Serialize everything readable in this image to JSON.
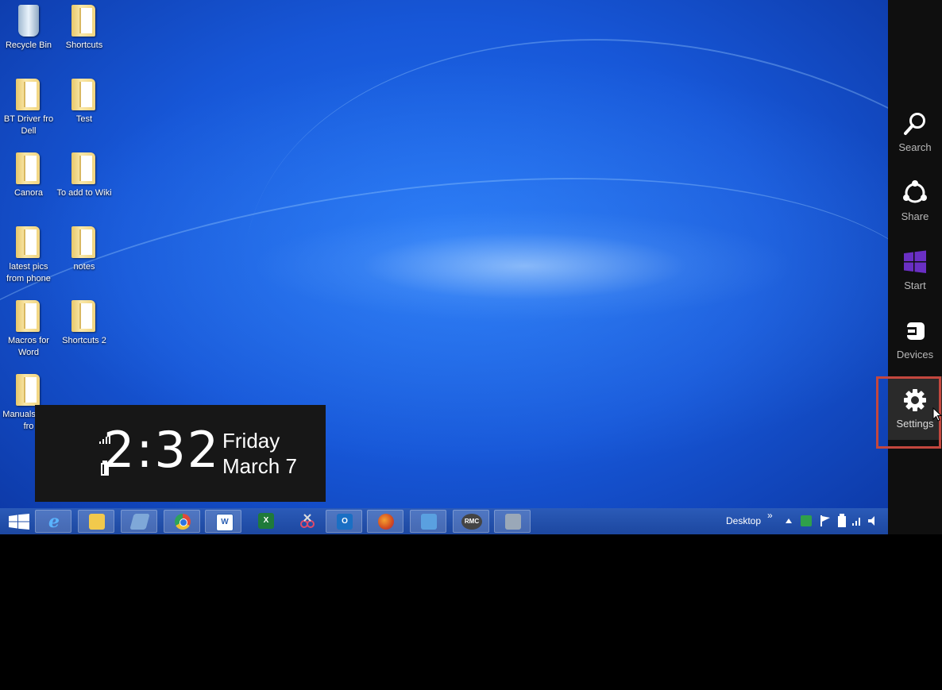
{
  "desktop_icons": [
    {
      "label": "Recycle Bin",
      "type": "bin"
    },
    {
      "label": "Shortcuts",
      "type": "folder"
    },
    {
      "label": "BT Driver fro Dell",
      "type": "folder"
    },
    {
      "label": "Test",
      "type": "folder"
    },
    {
      "label": "Canora",
      "type": "folder"
    },
    {
      "label": "To add to Wiki",
      "type": "folder"
    },
    {
      "label": "latest pics from phone",
      "type": "folder"
    },
    {
      "label": "notes",
      "type": "folder"
    },
    {
      "label": "Macros for Word",
      "type": "folder"
    },
    {
      "label": "Shortcuts 2",
      "type": "folder"
    },
    {
      "label": "Manuals past fro",
      "type": "folder"
    }
  ],
  "clock": {
    "time": "2:32",
    "day": "Friday",
    "date": "March 7"
  },
  "charms": [
    {
      "label": "Search",
      "icon": "search-icon"
    },
    {
      "label": "Share",
      "icon": "share-icon"
    },
    {
      "label": "Start",
      "icon": "windows-logo-icon"
    },
    {
      "label": "Devices",
      "icon": "devices-icon"
    },
    {
      "label": "Settings",
      "icon": "gear-icon"
    }
  ],
  "taskbar": {
    "apps": [
      {
        "name": "internet-explorer",
        "glyph": "e",
        "color": "#3aa0ff"
      },
      {
        "name": "file-explorer",
        "glyph": "",
        "color": "#f2c94c"
      },
      {
        "name": "notepad-app",
        "glyph": "",
        "color": "#7fa8d8"
      },
      {
        "name": "chrome",
        "glyph": "",
        "color": "#e04a3a"
      },
      {
        "name": "word",
        "glyph": "W",
        "color": "#2b5fb3"
      },
      {
        "name": "excel",
        "glyph": "X",
        "color": "#1f7a3a"
      },
      {
        "name": "snipping-tool",
        "glyph": "",
        "color": "#c0c0c0"
      },
      {
        "name": "outlook",
        "glyph": "O",
        "color": "#1a6fc4"
      },
      {
        "name": "firefox",
        "glyph": "",
        "color": "#e0702a"
      },
      {
        "name": "remote-desktop",
        "glyph": "",
        "color": "#5aa0e0"
      },
      {
        "name": "rmc-app",
        "glyph": "RMC",
        "color": "#555555"
      },
      {
        "name": "printer-app",
        "glyph": "",
        "color": "#9aa8b8"
      }
    ],
    "tray_label": "Desktop",
    "tray_chevron": "»"
  },
  "colors": {
    "highlight": "#c4473e",
    "start_tile": "#6a2fc4"
  }
}
